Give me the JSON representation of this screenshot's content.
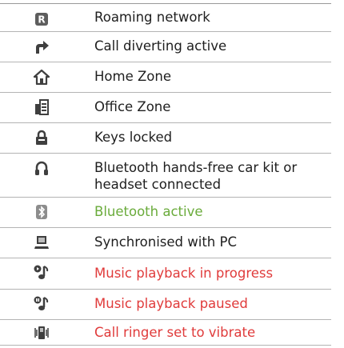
{
  "colors": {
    "text": "#1e1e1e",
    "green": "#6aab3b",
    "red": "#e03b3b",
    "divider": "#b4b4b4"
  },
  "rows": [
    {
      "icon": "roaming-network-icon",
      "label": "Roaming network",
      "color": "#1e1e1e"
    },
    {
      "icon": "call-divert-icon",
      "label": "Call diverting active",
      "color": "#1e1e1e"
    },
    {
      "icon": "home-zone-icon",
      "label": "Home Zone",
      "color": "#1e1e1e"
    },
    {
      "icon": "office-zone-icon",
      "label": "Office Zone",
      "color": "#1e1e1e"
    },
    {
      "icon": "keys-locked-icon",
      "label": "Keys locked",
      "color": "#1e1e1e"
    },
    {
      "icon": "bluetooth-headset-icon",
      "label": "Bluetooth hands-free car kit or",
      "label2": "headset connected",
      "color": "#1e1e1e"
    },
    {
      "icon": "bluetooth-active-icon",
      "label": "Bluetooth active",
      "color": "#6aab3b"
    },
    {
      "icon": "pc-sync-icon",
      "label": "Synchronised with PC",
      "color": "#1e1e1e"
    },
    {
      "icon": "music-playing-icon",
      "label": "Music playback in progress",
      "color": "#e03b3b"
    },
    {
      "icon": "music-paused-icon",
      "label": "Music playback paused",
      "color": "#e03b3b"
    },
    {
      "icon": "vibrate-icon",
      "label": "Call ringer set to vibrate",
      "color": "#e03b3b"
    }
  ]
}
